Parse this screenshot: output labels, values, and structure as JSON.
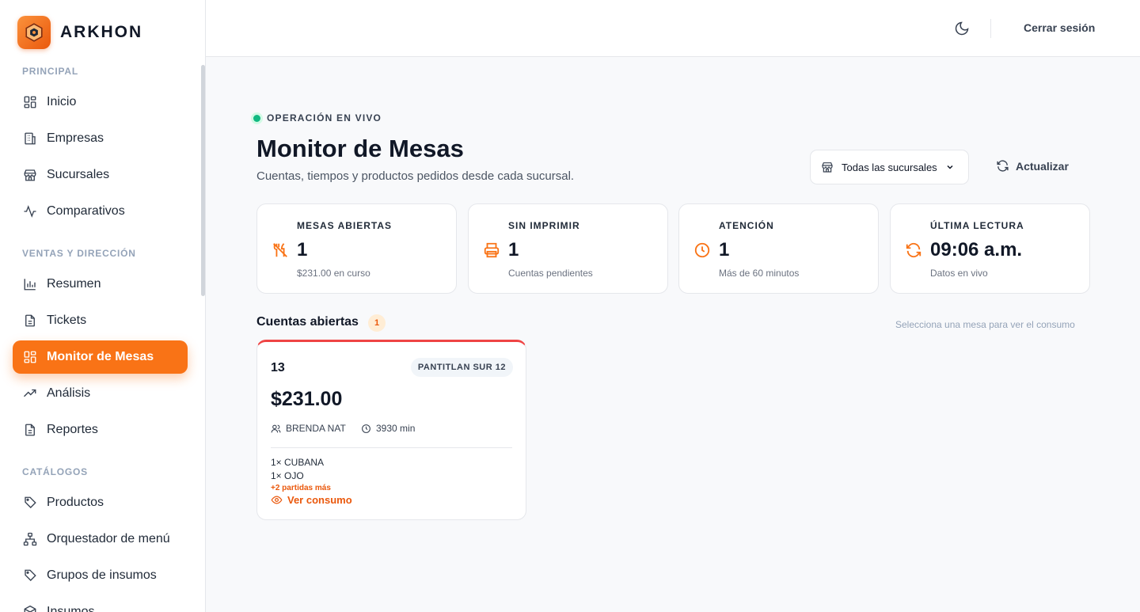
{
  "brand": {
    "name": "ARKHON"
  },
  "header": {
    "logout_label": "Cerrar sesión"
  },
  "sidebar": {
    "sections": [
      {
        "label": "PRINCIPAL",
        "items": [
          {
            "label": "Inicio",
            "icon": "grid-icon"
          },
          {
            "label": "Empresas",
            "icon": "building-icon"
          },
          {
            "label": "Sucursales",
            "icon": "store-icon"
          },
          {
            "label": "Comparativos",
            "icon": "activity-icon"
          }
        ]
      },
      {
        "label": "VENTAS Y DIRECCIÓN",
        "items": [
          {
            "label": "Resumen",
            "icon": "bar-chart-icon"
          },
          {
            "label": "Tickets",
            "icon": "document-icon"
          },
          {
            "label": "Monitor de Mesas",
            "icon": "grid-icon",
            "active": true
          },
          {
            "label": "Análisis",
            "icon": "trending-up-icon"
          },
          {
            "label": "Reportes",
            "icon": "document-icon"
          }
        ]
      },
      {
        "label": "CATÁLOGOS",
        "items": [
          {
            "label": "Productos",
            "icon": "tag-icon"
          },
          {
            "label": "Orquestador de menú",
            "icon": "sitemap-icon"
          },
          {
            "label": "Grupos de insumos",
            "icon": "tag-icon"
          },
          {
            "label": "Insumos",
            "icon": "box-icon"
          }
        ]
      }
    ]
  },
  "main": {
    "live_label": "OPERACIÓN EN VIVO",
    "title": "Monitor de Mesas",
    "subtitle": "Cuentas, tiempos y productos pedidos desde cada sucursal.",
    "branch_select": {
      "value": "Todas las sucursales"
    },
    "refresh_label": "Actualizar",
    "stats": [
      {
        "label": "MESAS ABIERTAS",
        "value": "1",
        "sub": "$231.00 en curso",
        "icon": "utensils-off-icon"
      },
      {
        "label": "SIN IMPRIMIR",
        "value": "1",
        "sub": "Cuentas pendientes",
        "icon": "printer-icon"
      },
      {
        "label": "ATENCIÓN",
        "value": "1",
        "sub": "Más de 60 minutos",
        "icon": "clock-icon"
      },
      {
        "label": "ÚLTIMA LECTURA",
        "value": "09:06 a.m.",
        "sub": "Datos en vivo",
        "icon": "refresh-icon"
      }
    ],
    "accounts": {
      "title": "Cuentas abiertas",
      "count": "1",
      "hint": "Selecciona una mesa para ver el consumo",
      "tables": [
        {
          "number": "13",
          "branch": "PANTITLAN SUR 12",
          "amount": "$231.00",
          "waiter": "BRENDA NAT",
          "elapsed": "3930 min",
          "items": [
            "1× CUBANA",
            "1× OJO"
          ],
          "more": "+2 partidas más",
          "view_label": "Ver consumo",
          "accent_color": "#ef4444"
        }
      ]
    }
  },
  "colors": {
    "accent": "#f97316",
    "live": "#10b981",
    "alert": "#ef4444"
  }
}
